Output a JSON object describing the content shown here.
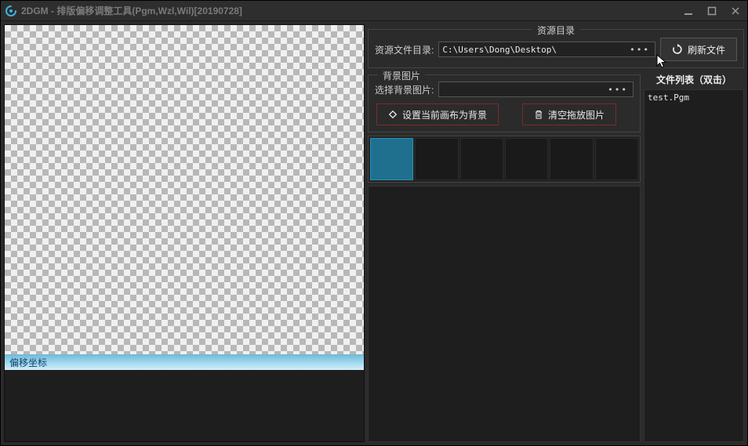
{
  "window": {
    "title": "2DGM - 排版偏移调整工具(Pgm,Wzl,Wil)[20190728]"
  },
  "canvas": {
    "offset_label": "偏移坐标"
  },
  "resource": {
    "group_label": "资源目录",
    "path_label": "资源文件目录:",
    "path_value": "C:\\Users\\Dong\\Desktop\\",
    "refresh_label": "刷新文件"
  },
  "background": {
    "group_label": "背景图片",
    "select_label": "选择背景图片:",
    "select_value": "",
    "set_canvas_bg_label": "设置当前画布为背景",
    "clear_drag_label": "清空拖放图片"
  },
  "file_list": {
    "header": "文件列表（双击）",
    "items": [
      "test.Pgm"
    ]
  },
  "icons": {
    "minimize": "minimize",
    "maximize": "maximize",
    "close": "close"
  }
}
